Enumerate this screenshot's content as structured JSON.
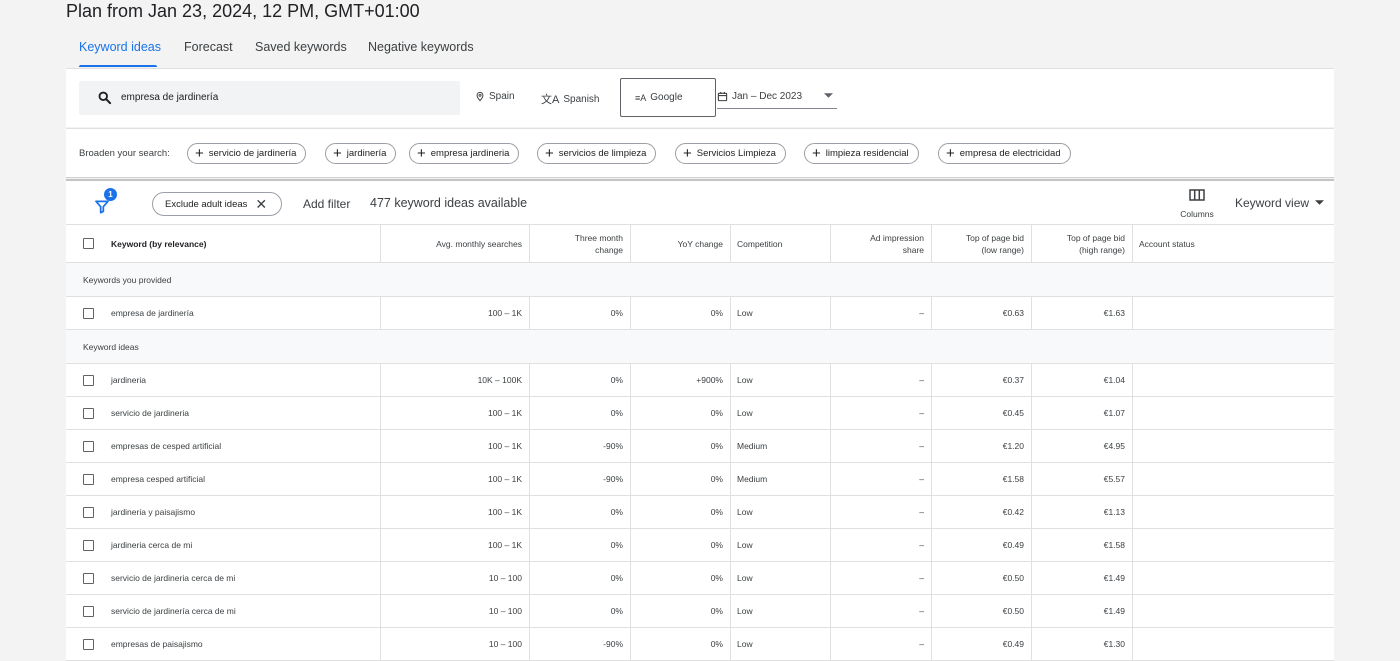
{
  "plan_title": "Plan from Jan 23, 2024, 12 PM, GMT+01:00",
  "tabs": [
    {
      "label": "Keyword ideas",
      "active": true
    },
    {
      "label": "Forecast",
      "active": false
    },
    {
      "label": "Saved keywords",
      "active": false
    },
    {
      "label": "Negative keywords",
      "active": false
    }
  ],
  "search": {
    "query": "empresa de jardinería",
    "location": "Spain",
    "language": "Spanish",
    "network": "Google",
    "date_range": "Jan – Dec 2023"
  },
  "broaden": {
    "label": "Broaden your search:",
    "chips": [
      "servicio de jardinería",
      "jardinería",
      "empresa jardineria",
      "servicios de limpieza",
      "Servicios Limpieza",
      "limpieza residencial",
      "empresa de electricidad"
    ]
  },
  "filters": {
    "badge": "1",
    "exclude_chip": "Exclude adult ideas",
    "add_filter": "Add filter",
    "count_text": "477 keyword ideas available",
    "columns_label": "Columns",
    "view_label": "Keyword view"
  },
  "table": {
    "headers": {
      "keyword": "Keyword (by relevance)",
      "avg": "Avg. monthly searches",
      "three_month_1": "Three month",
      "three_month_2": "change",
      "yoy": "YoY change",
      "competition": "Competition",
      "ad_share_1": "Ad impression",
      "ad_share_2": "share",
      "bid_low_1": "Top of page bid",
      "bid_low_2": "(low range)",
      "bid_high_1": "Top of page bid",
      "bid_high_2": "(high range)",
      "status": "Account status"
    },
    "groups": {
      "provided": "Keywords you provided",
      "ideas": "Keyword ideas"
    },
    "provided_rows": [
      {
        "keyword": "empresa de jardinería",
        "avg": "100 – 1K",
        "three": "0%",
        "yoy": "0%",
        "comp": "Low",
        "share": "–",
        "low": "€0.63",
        "high": "€1.63"
      }
    ],
    "idea_rows": [
      {
        "keyword": "jardineria",
        "avg": "10K – 100K",
        "three": "0%",
        "yoy": "+900%",
        "comp": "Low",
        "share": "–",
        "low": "€0.37",
        "high": "€1.04"
      },
      {
        "keyword": "servicio de jardineria",
        "avg": "100 – 1K",
        "three": "0%",
        "yoy": "0%",
        "comp": "Low",
        "share": "–",
        "low": "€0.45",
        "high": "€1.07"
      },
      {
        "keyword": "empresas de cesped artificial",
        "avg": "100 – 1K",
        "three": "-90%",
        "yoy": "0%",
        "comp": "Medium",
        "share": "–",
        "low": "€1.20",
        "high": "€4.95"
      },
      {
        "keyword": "empresa cesped artificial",
        "avg": "100 – 1K",
        "three": "-90%",
        "yoy": "0%",
        "comp": "Medium",
        "share": "–",
        "low": "€1.58",
        "high": "€5.57"
      },
      {
        "keyword": "jardineria y paisajismo",
        "avg": "100 – 1K",
        "three": "0%",
        "yoy": "0%",
        "comp": "Low",
        "share": "–",
        "low": "€0.42",
        "high": "€1.13"
      },
      {
        "keyword": "jardineria cerca de mi",
        "avg": "100 – 1K",
        "three": "0%",
        "yoy": "0%",
        "comp": "Low",
        "share": "–",
        "low": "€0.49",
        "high": "€1.58"
      },
      {
        "keyword": "servicio de jardineria cerca de mi",
        "avg": "10 – 100",
        "three": "0%",
        "yoy": "0%",
        "comp": "Low",
        "share": "–",
        "low": "€0.50",
        "high": "€1.49"
      },
      {
        "keyword": "servicio de jardinería cerca de mi",
        "avg": "10 – 100",
        "three": "0%",
        "yoy": "0%",
        "comp": "Low",
        "share": "–",
        "low": "€0.50",
        "high": "€1.49"
      },
      {
        "keyword": "empresas de paisajismo",
        "avg": "10 – 100",
        "three": "-90%",
        "yoy": "0%",
        "comp": "Low",
        "share": "–",
        "low": "€0.49",
        "high": "€1.30"
      }
    ]
  },
  "colors": {
    "accent": "#1a73e8",
    "page_bg": "#f3f3f3"
  }
}
